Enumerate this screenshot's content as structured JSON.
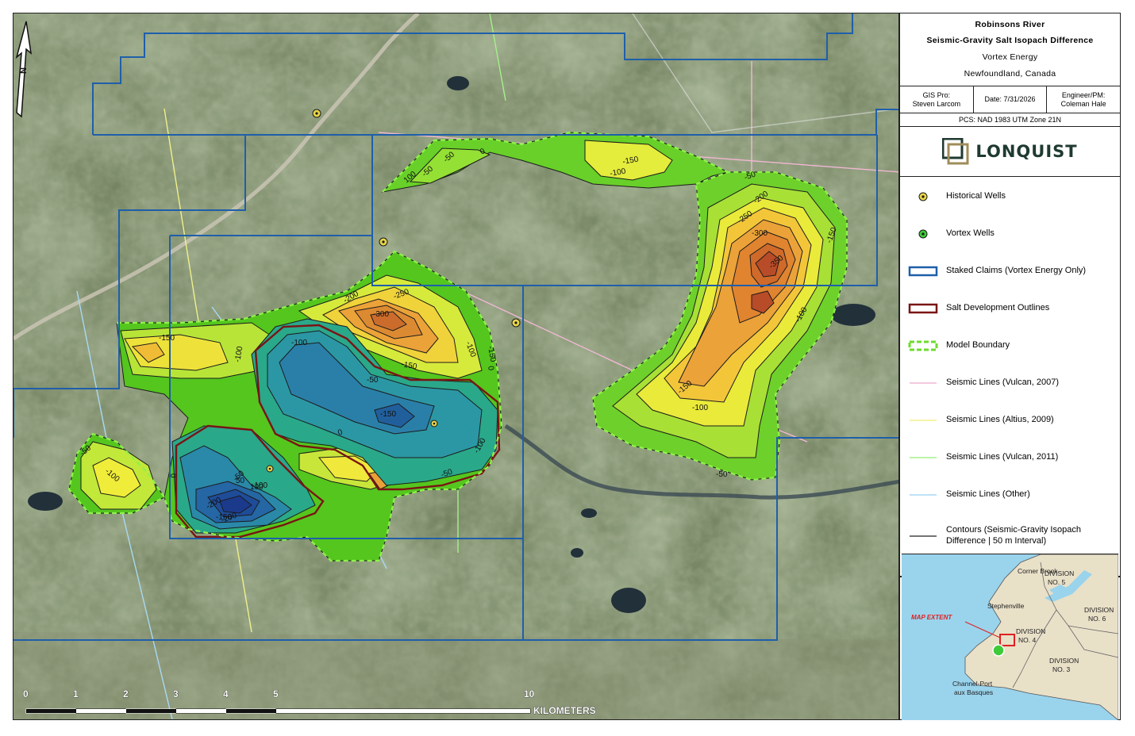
{
  "title_block": {
    "title": "Robinsons River",
    "subtitle": "Seismic-Gravity Salt Isopach Difference",
    "company": "Vortex Energy",
    "location": "Newfoundland, Canada"
  },
  "credits": {
    "gis_pro": "GIS Pro:",
    "gis_pro_name": "Steven Larcom",
    "date": "Date: 7/31/2026",
    "engineer": "Engineer/PM:",
    "engineer_name": "Coleman Hale"
  },
  "pcs": "PCS: NAD 1983 UTM Zone 21N",
  "logo": {
    "text": "LONQUIST"
  },
  "legend": [
    {
      "label": "Historical Wells",
      "symbol": "historical-well"
    },
    {
      "label": "Vortex Wells",
      "symbol": "vortex-well"
    },
    {
      "label": "Staked Claims (Vortex Energy Only)",
      "symbol": "staked-claims",
      "color": "#1f5faa"
    },
    {
      "label": "Salt Development Outlines",
      "symbol": "salt-outline",
      "color": "#7a1414"
    },
    {
      "label": "Model Boundary",
      "symbol": "model-boundary",
      "color": "#6ddc2c"
    },
    {
      "label": "Seismic Lines (Vulcan, 2007)",
      "symbol": "line",
      "color": "#f2b7d4"
    },
    {
      "label": "Seismic Lines (Altius, 2009)",
      "symbol": "line",
      "color": "#f0f08a"
    },
    {
      "label": "Seismic Lines (Vulcan, 2011)",
      "symbol": "line",
      "color": "#a6f08c"
    },
    {
      "label": "Seismic Lines (Other)",
      "symbol": "line",
      "color": "#a9d8f2"
    },
    {
      "label": "Contours (Seismic-Gravity Isopach Difference | 50 m Interval)",
      "symbol": "contour",
      "color": "#222222"
    }
  ],
  "inset": {
    "labels": {
      "corner_brook": "Corner Brook",
      "stephenville": "Stephenville",
      "division5a": "DIVISION",
      "division5b": "NO. 5",
      "division6a": "DIVISION",
      "division6b": "NO. 6",
      "division4a": "DIVISION",
      "division4b": "NO. 4",
      "division3a": "DIVISION",
      "division3b": "NO. 3",
      "channel_a": "Channel-Port",
      "channel_b": "aux Basques",
      "map_extent": "MAP EXTENT"
    }
  },
  "north_arrow": {
    "letter": "N"
  },
  "scale_bar": {
    "ticks": [
      "0",
      "1",
      "2",
      "3",
      "4",
      "5",
      "10"
    ],
    "unit": "KILOMETERS"
  },
  "contour_labels": [
    "-50",
    "100",
    "-50",
    "0",
    "-150",
    "-100",
    "-50",
    "-200",
    "-250",
    "-300",
    "-350",
    "-150",
    "-100",
    "-150",
    "-100",
    "-200",
    "-250",
    "-300",
    "-150",
    "-100",
    "-100",
    "-50",
    "-150",
    "0",
    "-100",
    "-150",
    "0",
    "-50",
    "100",
    "-50",
    "-100",
    "-200",
    "0",
    "-50",
    "-50",
    "-100",
    "-150",
    "-200",
    "-150",
    "-100",
    "50"
  ]
}
